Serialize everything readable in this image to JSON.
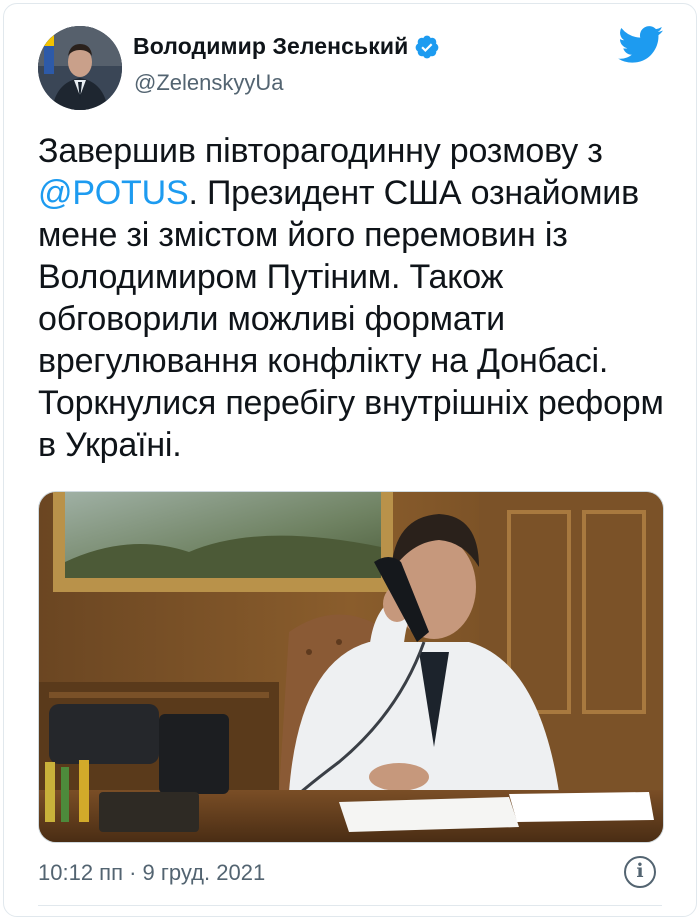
{
  "author": {
    "display_name": "Володимир Зеленський",
    "handle": "@ZelenskyyUa",
    "verified": true,
    "avatar_icon": "profile-photo"
  },
  "tweet": {
    "text_before_mention": "Завершив півторагодинну розмову з",
    "mention": "@POTUS",
    "text_after_mention": ". Президент США ознайомив мене зі змістом його перемовин із Володимиром Путіним. Також обговорили можливі формати врегулювання конфлікту на Донбасі. Торкнулися перебігу внутрішніх реформ в Україні."
  },
  "media": {
    "type": "photo"
  },
  "footer": {
    "timestamp": "10:12 пп · 9 груд. 2021",
    "info_icon": "info-icon"
  },
  "colors": {
    "link": "#1d9bf0",
    "twitter_blue": "#1d9bf0",
    "secondary_text": "#536471"
  }
}
